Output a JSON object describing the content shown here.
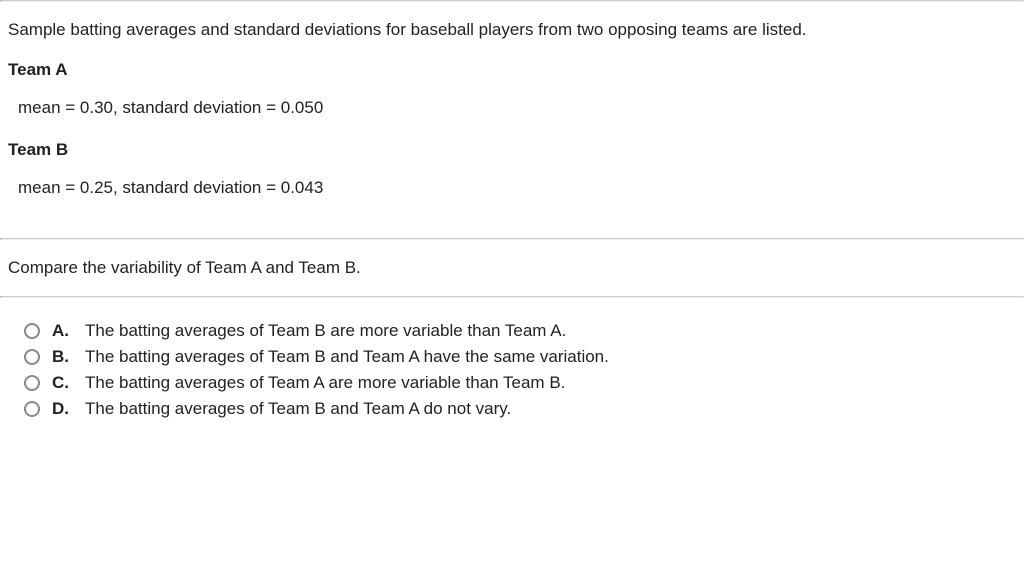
{
  "intro": "Sample batting averages and standard deviations for baseball players from two opposing teams are listed.",
  "teamA": {
    "heading": "Team A",
    "stats": "mean = 0.30, standard deviation = 0.050"
  },
  "teamB": {
    "heading": "Team B",
    "stats": "mean = 0.25, standard deviation = 0.043"
  },
  "question": "Compare the variability of Team A and Team B.",
  "options": [
    {
      "letter": "A.",
      "text": "The batting averages of Team B are more variable than Team A."
    },
    {
      "letter": "B.",
      "text": "The batting averages of Team B and Team A have the same variation."
    },
    {
      "letter": "C.",
      "text": "The batting averages of Team A are more variable than Team B."
    },
    {
      "letter": "D.",
      "text": "The batting averages of Team B and Team A do not vary."
    }
  ]
}
